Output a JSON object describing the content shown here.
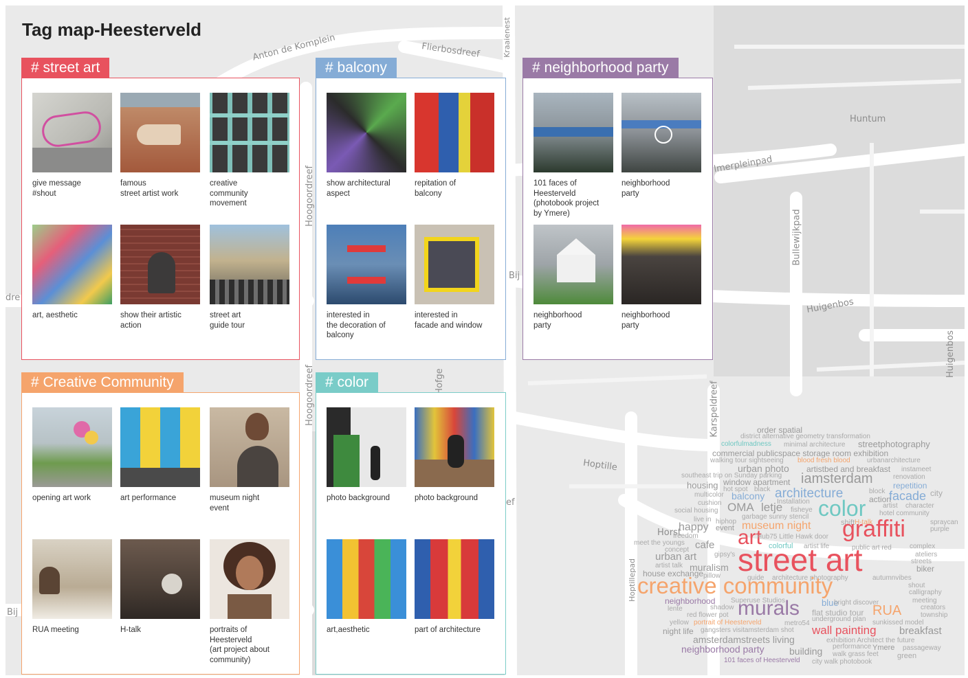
{
  "page": {
    "title": "Tag map-Heesterveld"
  },
  "map": {
    "streets": [
      "Anton de Komplein",
      "Flierbosdreef",
      "Kraaienest",
      "Huntum",
      "lmerpleinpad",
      "Bullewijkpad",
      "Huigenbos",
      "Huigenbos",
      "Hoogoordreef",
      "Hoogoordreef",
      "Hoptille",
      "Karspeldreef",
      "Hoptillepad",
      "Horst",
      "Hofge",
      "Bij",
      "Bij",
      "dre",
      "ef"
    ]
  },
  "panels": [
    {
      "tag": "# street art",
      "color": "#e8525e",
      "items": [
        {
          "caption": "give message\n#shout",
          "icon": "photo-graffiti-wall"
        },
        {
          "caption": "famous\nstreet artist work",
          "icon": "photo-fish-mural"
        },
        {
          "caption": "creative\ncommunity\nmovement",
          "icon": "photo-window-portraits"
        },
        {
          "caption": "art, aesthetic",
          "icon": "photo-colorful-building"
        },
        {
          "caption": "show their artistic\naction",
          "icon": "photo-painter"
        },
        {
          "caption": "street art\nguide tour",
          "icon": "photo-tour-group"
        }
      ]
    },
    {
      "tag": "# balcony",
      "color": "#85acd6",
      "items": [
        {
          "caption": "show architectural\naspect",
          "icon": "photo-balcony-facade"
        },
        {
          "caption": "repitation of\nbalcony",
          "icon": "photo-red-blue-balcony"
        },
        {
          "caption": "interested in\nthe decoration of\nbalcony",
          "icon": "photo-decorated-balcony"
        },
        {
          "caption": "interested in\nfacade and window",
          "icon": "photo-yellow-window"
        }
      ]
    },
    {
      "tag": "# neighborhood party",
      "color": "#9a7aa6",
      "items": [
        {
          "caption": "101 faces of\nHeesterveld\n(photobook project\nby Ymere)",
          "icon": "photo-street-crowd"
        },
        {
          "caption": "neighborhood\nparty",
          "icon": "photo-dancers"
        },
        {
          "caption": "neighborhood\nparty",
          "icon": "photo-party-tent"
        },
        {
          "caption": "neighborhood\nparty",
          "icon": "photo-party-stage"
        }
      ]
    },
    {
      "tag": "# Creative Community",
      "color": "#f5a46c",
      "items": [
        {
          "caption": "opening art work",
          "icon": "photo-balloons"
        },
        {
          "caption": "art performance",
          "icon": "photo-colorful-facade"
        },
        {
          "caption": "museum night\nevent",
          "icon": "photo-couple"
        },
        {
          "caption": "RUA meeting",
          "icon": "photo-meeting"
        },
        {
          "caption": "H-talk",
          "icon": "photo-talk"
        },
        {
          "caption": "portraits of\nHeesterveld\n(art project about\ncommunity)",
          "icon": "photo-portrait"
        }
      ]
    },
    {
      "tag": "# color",
      "color": "#7accc8",
      "items": [
        {
          "caption": "photo background",
          "icon": "photo-green-door"
        },
        {
          "caption": "photo background",
          "icon": "photo-man-sitting"
        },
        {
          "caption": "art,aesthetic",
          "icon": "photo-color-blocks"
        },
        {
          "caption": "part of architecture",
          "icon": "photo-red-yellow-facade"
        }
      ]
    }
  ],
  "wordcloud": [
    {
      "t": "order spatial",
      "c": "#999999"
    },
    {
      "t": "district alternative geometry transformation",
      "c": "#aaaaaa"
    },
    {
      "t": "colorfulmadness",
      "c": "#6fc8c2"
    },
    {
      "t": "minimal architecture",
      "c": "#aaaaaa"
    },
    {
      "t": "streetphotography",
      "c": "#999999"
    },
    {
      "t": "commercial publicspace storage room exhibition",
      "c": "#999999"
    },
    {
      "t": "walking tour sightseeing",
      "c": "#aaaaaa"
    },
    {
      "t": "blood fresh blood",
      "c": "#f5a46c"
    },
    {
      "t": "urbanarchitecture",
      "c": "#aaaaaa"
    },
    {
      "t": "urban photo",
      "c": "#999999"
    },
    {
      "t": "artistbed and breakfast",
      "c": "#999999"
    },
    {
      "t": "instameet",
      "c": "#aaaaaa"
    },
    {
      "t": "southeast trip on Sunday parking",
      "c": "#aaaaaa"
    },
    {
      "t": "iamsterdam",
      "c": "#999999"
    },
    {
      "t": "renovation",
      "c": "#aaaaaa"
    },
    {
      "t": "housing",
      "c": "#999999"
    },
    {
      "t": "window apartment",
      "c": "#999999"
    },
    {
      "t": "repetition",
      "c": "#85acd6"
    },
    {
      "t": "hot spot",
      "c": "#aaaaaa"
    },
    {
      "t": "black",
      "c": "#aaaaaa"
    },
    {
      "t": "block",
      "c": "#aaaaaa"
    },
    {
      "t": "multicolor",
      "c": "#aaaaaa"
    },
    {
      "t": "balcony",
      "c": "#85acd6"
    },
    {
      "t": "architecture",
      "c": "#85acd6"
    },
    {
      "t": "action",
      "c": "#999999"
    },
    {
      "t": "facade",
      "c": "#85acd6"
    },
    {
      "t": "city",
      "c": "#aaaaaa"
    },
    {
      "t": "cushion",
      "c": "#aaaaaa"
    },
    {
      "t": "Installation",
      "c": "#aaaaaa"
    },
    {
      "t": "artist",
      "c": "#aaaaaa"
    },
    {
      "t": "character",
      "c": "#aaaaaa"
    },
    {
      "t": "social housing",
      "c": "#aaaaaa"
    },
    {
      "t": "OMA",
      "c": "#999999"
    },
    {
      "t": "letje",
      "c": "#999999"
    },
    {
      "t": "fisheye",
      "c": "#aaaaaa"
    },
    {
      "t": "color",
      "c": "#6fc8c2"
    },
    {
      "t": "hotel community",
      "c": "#aaaaaa"
    },
    {
      "t": "live in",
      "c": "#aaaaaa"
    },
    {
      "t": "garbage sunny stencil",
      "c": "#aaaaaa"
    },
    {
      "t": "hiphop",
      "c": "#aaaaaa"
    },
    {
      "t": "museum night",
      "c": "#f5a46c"
    },
    {
      "t": "shift",
      "c": "#aaaaaa"
    },
    {
      "t": "H-talk",
      "c": "#f5a46c"
    },
    {
      "t": "spraycan",
      "c": "#aaaaaa"
    },
    {
      "t": "happy",
      "c": "#999999"
    },
    {
      "t": "event",
      "c": "#999999"
    },
    {
      "t": "graffiti",
      "c": "#e8525e"
    },
    {
      "t": "purple",
      "c": "#aaaaaa"
    },
    {
      "t": "freedom",
      "c": "#aaaaaa"
    },
    {
      "t": "meet the youngs",
      "c": "#aaaaaa"
    },
    {
      "t": "art",
      "c": "#e8525e"
    },
    {
      "t": "Hub75 Little Hawk door",
      "c": "#aaaaaa"
    },
    {
      "t": "concept",
      "c": "#aaaaaa"
    },
    {
      "t": "cafe",
      "c": "#999999"
    },
    {
      "t": "colorful",
      "c": "#6fc8c2"
    },
    {
      "t": "artist life",
      "c": "#aaaaaa"
    },
    {
      "t": "public art red",
      "c": "#aaaaaa"
    },
    {
      "t": "complex",
      "c": "#aaaaaa"
    },
    {
      "t": "urban art",
      "c": "#999999"
    },
    {
      "t": "gipsy's",
      "c": "#aaaaaa"
    },
    {
      "t": "ateliers",
      "c": "#aaaaaa"
    },
    {
      "t": "streets",
      "c": "#aaaaaa"
    },
    {
      "t": "artist talk",
      "c": "#aaaaaa"
    },
    {
      "t": "street art",
      "c": "#e8525e"
    },
    {
      "t": "biker",
      "c": "#999999"
    },
    {
      "t": "house exchange",
      "c": "#999999"
    },
    {
      "t": "muralism",
      "c": "#999999"
    },
    {
      "t": "pillow",
      "c": "#aaaaaa"
    },
    {
      "t": "guide",
      "c": "#aaaaaa"
    },
    {
      "t": "architecture photography",
      "c": "#aaaaaa"
    },
    {
      "t": "autumnvibes",
      "c": "#aaaaaa"
    },
    {
      "t": "shout",
      "c": "#aaaaaa"
    },
    {
      "t": "creative community",
      "c": "#f5a46c"
    },
    {
      "t": "calligraphy",
      "c": "#aaaaaa"
    },
    {
      "t": "neighborhood",
      "c": "#9a7aa6"
    },
    {
      "t": "Superuse Studios",
      "c": "#aaaaaa"
    },
    {
      "t": "meeting",
      "c": "#aaaaaa"
    },
    {
      "t": "lente",
      "c": "#aaaaaa"
    },
    {
      "t": "shadow",
      "c": "#aaaaaa"
    },
    {
      "t": "murals",
      "c": "#9a7aa6"
    },
    {
      "t": "blue",
      "c": "#85acd6"
    },
    {
      "t": "bright discover",
      "c": "#aaaaaa"
    },
    {
      "t": "creators",
      "c": "#aaaaaa"
    },
    {
      "t": "red flower pot",
      "c": "#aaaaaa"
    },
    {
      "t": "flat studio tour",
      "c": "#aaaaaa"
    },
    {
      "t": "RUA",
      "c": "#f5a46c"
    },
    {
      "t": "township",
      "c": "#aaaaaa"
    },
    {
      "t": "yellow",
      "c": "#aaaaaa"
    },
    {
      "t": "portrait of Heesterveld",
      "c": "#f5a46c"
    },
    {
      "t": "metro54",
      "c": "#aaaaaa"
    },
    {
      "t": "underground plan",
      "c": "#aaaaaa"
    },
    {
      "t": "sunkissed model",
      "c": "#aaaaaa"
    },
    {
      "t": "night life",
      "c": "#999999"
    },
    {
      "t": "gangsters visitamsterdam shot",
      "c": "#aaaaaa"
    },
    {
      "t": "wall painting",
      "c": "#e8525e"
    },
    {
      "t": "breakfast",
      "c": "#999999"
    },
    {
      "t": "amsterdamstreets living",
      "c": "#999999"
    },
    {
      "t": "exhibition Architect the future",
      "c": "#aaaaaa"
    },
    {
      "t": "neighborhood party",
      "c": "#9a7aa6"
    },
    {
      "t": "building",
      "c": "#999999"
    },
    {
      "t": "performance",
      "c": "#aaaaaa"
    },
    {
      "t": "Ymere",
      "c": "#999999"
    },
    {
      "t": "passageway",
      "c": "#aaaaaa"
    },
    {
      "t": "walk grass feet",
      "c": "#aaaaaa"
    },
    {
      "t": "green",
      "c": "#aaaaaa"
    },
    {
      "t": "101 faces of Heesterveld",
      "c": "#9a7aa6"
    },
    {
      "t": "city walk photobook",
      "c": "#aaaaaa"
    }
  ]
}
